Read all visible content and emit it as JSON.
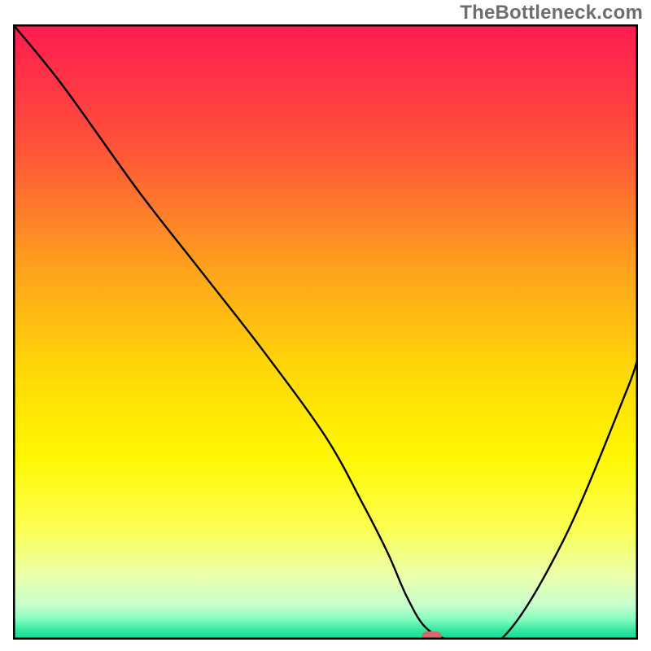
{
  "watermark": "TheBottleneck.com",
  "chart_data": {
    "type": "line",
    "title": "",
    "xlabel": "",
    "ylabel": "",
    "xlim": [
      0,
      100
    ],
    "ylim": [
      0,
      100
    ],
    "grid": false,
    "background": {
      "type": "gradient",
      "stops": [
        {
          "pos": 0.0,
          "color": "#ff1b52"
        },
        {
          "pos": 0.2,
          "color": "#ff5338"
        },
        {
          "pos": 0.4,
          "color": "#ffa31c"
        },
        {
          "pos": 0.55,
          "color": "#ffd409"
        },
        {
          "pos": 0.7,
          "color": "#fff700"
        },
        {
          "pos": 0.82,
          "color": "#fbff52"
        },
        {
          "pos": 0.9,
          "color": "#eaffb0"
        },
        {
          "pos": 0.945,
          "color": "#c4ffce"
        },
        {
          "pos": 0.965,
          "color": "#8cfdc1"
        },
        {
          "pos": 0.985,
          "color": "#33e9a0"
        },
        {
          "pos": 1.0,
          "color": "#09d893"
        }
      ]
    },
    "series": [
      {
        "name": "bottleneck-curve",
        "x": [
          0,
          8,
          20,
          30,
          40,
          50,
          56,
          60,
          63,
          66,
          70,
          78,
          88,
          98,
          100
        ],
        "y": [
          100,
          90,
          73,
          60,
          47,
          33,
          22,
          14,
          7,
          2,
          0,
          0,
          16,
          40,
          46
        ]
      }
    ],
    "marker": {
      "name": "optimal-point",
      "x": 67,
      "y": 0,
      "color": "#d46a6a"
    }
  }
}
